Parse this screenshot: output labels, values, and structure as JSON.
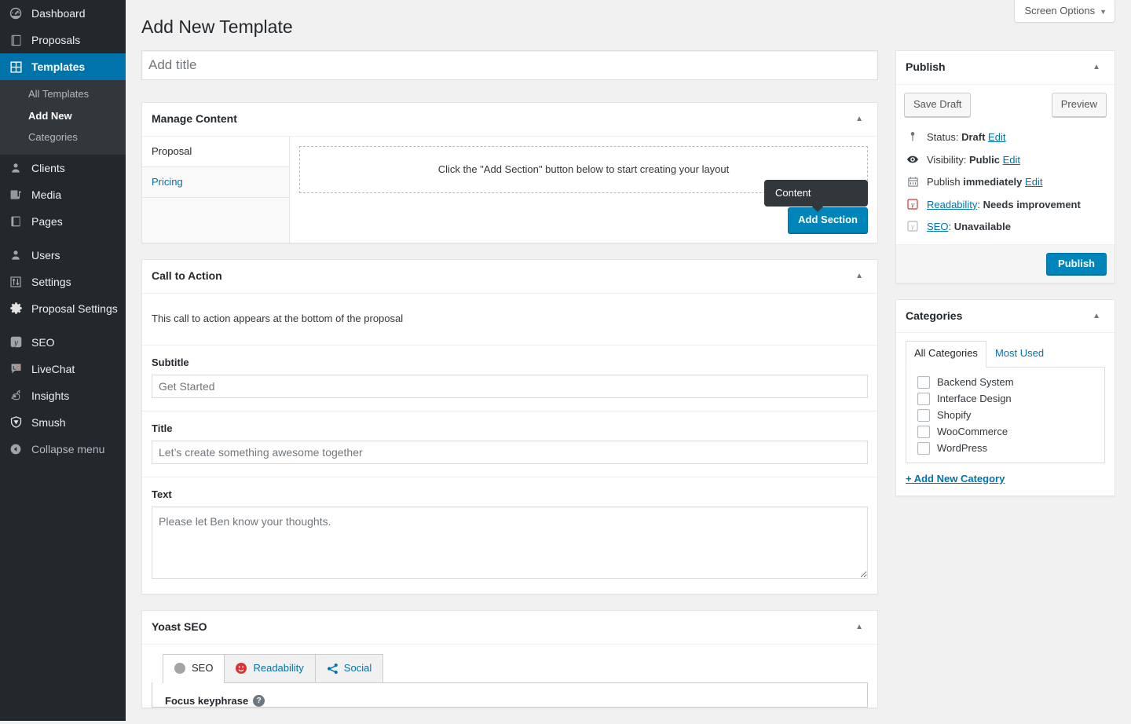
{
  "sidebar": {
    "items": [
      {
        "label": "Dashboard",
        "icon": "dashboard-icon",
        "state": "normal"
      },
      {
        "label": "Proposals",
        "icon": "book-icon",
        "state": "normal"
      },
      {
        "label": "Templates",
        "icon": "grid-icon",
        "state": "current"
      }
    ],
    "submenu": {
      "items": [
        {
          "label": "All Templates",
          "state": "normal"
        },
        {
          "label": "Add New",
          "state": "current"
        },
        {
          "label": "Categories",
          "state": "normal"
        }
      ]
    },
    "items2": [
      {
        "label": "Clients",
        "icon": "user-icon"
      },
      {
        "label": "Media",
        "icon": "media-icon"
      },
      {
        "label": "Pages",
        "icon": "page-icon"
      }
    ],
    "items3": [
      {
        "label": "Users",
        "icon": "users-icon"
      },
      {
        "label": "Settings",
        "icon": "sliders-icon"
      },
      {
        "label": "Proposal Settings",
        "icon": "gear-icon"
      }
    ],
    "items4": [
      {
        "label": "SEO",
        "icon": "yoast-icon"
      },
      {
        "label": "LiveChat",
        "icon": "livechat-icon"
      },
      {
        "label": "Insights",
        "icon": "insights-icon"
      },
      {
        "label": "Smush",
        "icon": "smush-icon"
      }
    ],
    "collapse": {
      "label": "Collapse menu",
      "icon": "collapse-arrow-icon"
    }
  },
  "header": {
    "screen_options_label": "Screen Options",
    "screen_options_caret": "▼",
    "page_title": "Add New Template"
  },
  "title_field": {
    "value": "",
    "placeholder": "Add title"
  },
  "manage_content": {
    "heading": "Manage Content",
    "toggle": "▲",
    "tabs": [
      {
        "label": "Proposal",
        "state": "active"
      },
      {
        "label": "Pricing",
        "state": "link"
      }
    ],
    "dropzone_text": "Click the \"Add Section\" button below to start creating your layout",
    "tooltip": "Content",
    "add_section_label": "Add Section"
  },
  "call_to_action": {
    "heading": "Call to Action",
    "toggle": "▲",
    "description": "This call to action appears at the bottom of the proposal",
    "fields": [
      {
        "label": "Subtitle",
        "value": "Get Started"
      },
      {
        "label": "Title",
        "value": "Let’s create something awesome together"
      },
      {
        "label": "Text",
        "value": "Please let Ben know your thoughts."
      }
    ]
  },
  "yoast": {
    "heading": "Yoast SEO",
    "toggle": "▲",
    "tabs": [
      {
        "label": "SEO",
        "state": "active",
        "dot_color": "#a4a4a4"
      },
      {
        "label": "Readability",
        "state": "normal",
        "dot_color": "#dc3232"
      },
      {
        "label": "Social",
        "state": "normal",
        "dot_color": "#0073aa"
      }
    ],
    "focus_keyphrase_label": "Focus keyphrase",
    "help_glyph": "?"
  },
  "publish_box": {
    "heading": "Publish",
    "toggle": "▲",
    "save_draft_label": "Save Draft",
    "preview_label": "Preview",
    "rows": [
      {
        "icon": "pin-icon",
        "prefix": "Status: ",
        "value": "Draft",
        "action": "Edit"
      },
      {
        "icon": "eye-icon",
        "prefix": "Visibility: ",
        "value": "Public",
        "action": "Edit"
      },
      {
        "icon": "calendar-icon",
        "prefix": "Publish ",
        "value": "immediately",
        "action": "Edit"
      }
    ],
    "readability": {
      "icon": "yoast-bad-icon",
      "link": "Readability",
      "separator": ": ",
      "value": "Needs improvement"
    },
    "seo": {
      "icon": "yoast-gray-icon",
      "link": "SEO",
      "separator": ": ",
      "value": "Unavailable"
    },
    "publish_label": "Publish"
  },
  "categories_box": {
    "heading": "Categories",
    "toggle": "▲",
    "tabs": [
      {
        "label": "All Categories",
        "state": "active"
      },
      {
        "label": "Most Used",
        "state": "normal"
      }
    ],
    "items": [
      {
        "label": "Backend System",
        "checked": false
      },
      {
        "label": "Interface Design",
        "checked": false
      },
      {
        "label": "Shopify",
        "checked": false
      },
      {
        "label": "WooCommerce",
        "checked": false
      },
      {
        "label": "WordPress",
        "checked": false
      }
    ],
    "add_new_label": "+ Add New Category"
  },
  "colors": {
    "admin_bg": "#23282d",
    "submenu_bg": "#32373c",
    "accent_blue": "#0073aa",
    "button_blue": "#0085ba",
    "link_blue": "#0073aa",
    "page_bg": "#f1f1f1",
    "red": "#dc3232"
  }
}
